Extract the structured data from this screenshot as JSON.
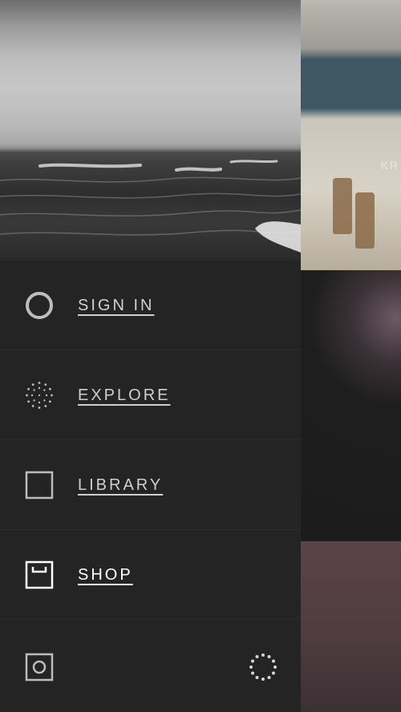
{
  "menu": {
    "items": [
      {
        "label": "SIGN IN",
        "icon": "circle-icon"
      },
      {
        "label": "EXPLORE",
        "icon": "dotted-circle-icon"
      },
      {
        "label": "LIBRARY",
        "icon": "square-icon"
      },
      {
        "label": "SHOP",
        "icon": "shop-box-icon"
      }
    ]
  },
  "footer": {
    "left_icon": "settings-square-circle-icon",
    "right_icon": "loading-spinner-icon"
  },
  "background": {
    "tile_text": "KR"
  },
  "colors": {
    "drawer": "#242424",
    "label": "#cfcfcf",
    "label_active": "#ffffff",
    "divider": "#2f2f2f"
  }
}
